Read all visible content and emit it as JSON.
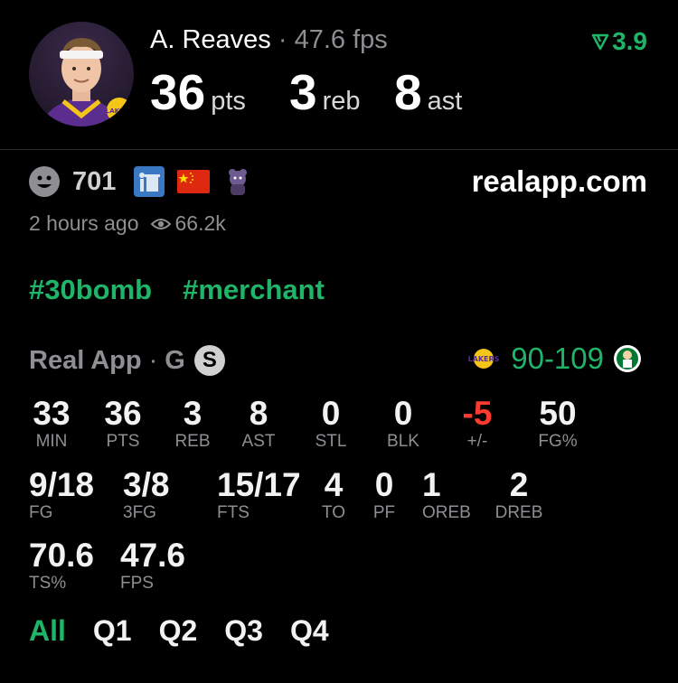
{
  "player": {
    "name": "A. Reaves",
    "separator": "·",
    "fps": "47.6 fps",
    "pts": "36",
    "pts_unit": "pts",
    "reb": "3",
    "reb_unit": "reb",
    "ast": "8",
    "ast_unit": "ast",
    "team_logo": "LAKERS"
  },
  "rating": {
    "icon": "arrow-down-icon",
    "value": "3.9",
    "color": "#1fb568"
  },
  "reactions": {
    "count": "701",
    "icons": [
      "smile-icon",
      "trash-icon",
      "china-flag-icon",
      "mascot-icon"
    ]
  },
  "site": "realapp.com",
  "meta": {
    "time": "2 hours ago",
    "views": "66.2k"
  },
  "tags": [
    "#30bomb",
    "#merchant"
  ],
  "game": {
    "source": "Real App",
    "dot": "·",
    "position": "G",
    "badge": "S",
    "score": "90-109",
    "home_logo": "LAKERS",
    "away_logo": "celtics-logo"
  },
  "stats_row1": [
    {
      "value": "33",
      "label": "MIN"
    },
    {
      "value": "36",
      "label": "PTS"
    },
    {
      "value": "3",
      "label": "REB"
    },
    {
      "value": "8",
      "label": "AST"
    },
    {
      "value": "0",
      "label": "STL"
    },
    {
      "value": "0",
      "label": "BLK"
    },
    {
      "value": "-5",
      "label": "+/-"
    },
    {
      "value": "50",
      "label": "FG%"
    }
  ],
  "stats_row2": [
    {
      "value": "9/18",
      "label": "FG"
    },
    {
      "value": "3/8",
      "label": "3FG"
    },
    {
      "value": "15/17",
      "label": "FTS"
    },
    {
      "value": "4",
      "label": "TO"
    },
    {
      "value": "0",
      "label": "PF"
    },
    {
      "value": "1",
      "label": "OREB"
    },
    {
      "value": "2",
      "label": "DREB"
    }
  ],
  "stats_row3": [
    {
      "value": "70.6",
      "label": "TS%"
    },
    {
      "value": "47.6",
      "label": "FPS"
    }
  ],
  "quarters": [
    "All",
    "Q1",
    "Q2",
    "Q3",
    "Q4"
  ],
  "colors": {
    "accent": "#1fb568",
    "negative": "#ff3b30",
    "muted": "#8e8e93",
    "background": "#000000"
  }
}
